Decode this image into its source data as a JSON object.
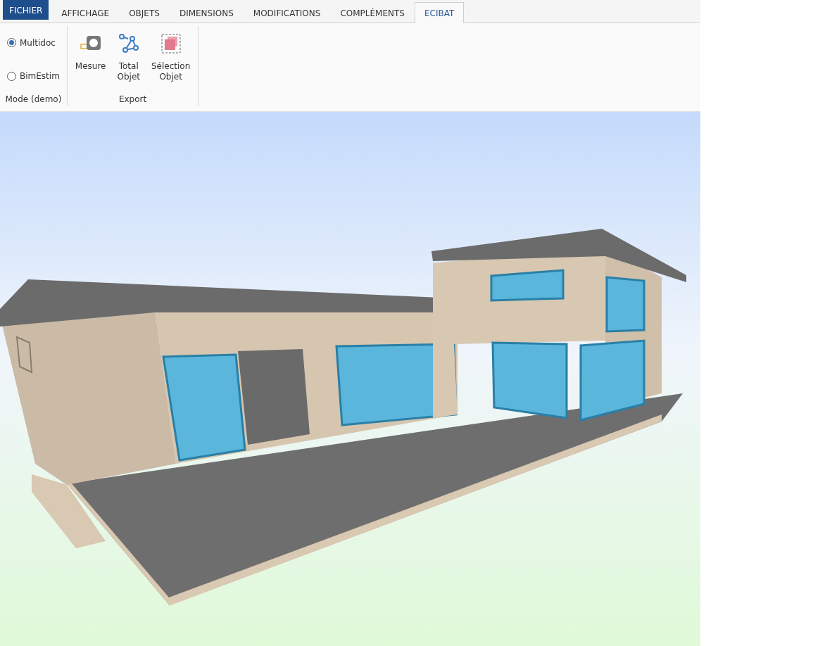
{
  "tabs": [
    {
      "label": "FICHIER",
      "kind": "file",
      "selected": false
    },
    {
      "label": "AFFICHAGE",
      "kind": "tab",
      "selected": false
    },
    {
      "label": "OBJETS",
      "kind": "tab",
      "selected": false
    },
    {
      "label": "DIMENSIONS",
      "kind": "tab",
      "selected": false
    },
    {
      "label": "MODIFICATIONS",
      "kind": "tab",
      "selected": false
    },
    {
      "label": "COMPLÉMENTS",
      "kind": "tab",
      "selected": false
    },
    {
      "label": "ECIBAT",
      "kind": "tab",
      "selected": true
    }
  ],
  "groups": [
    {
      "label": "Mode (demo)",
      "kind": "radios",
      "items": [
        {
          "label": "Multidoc",
          "selected": true
        },
        {
          "label": "BimEstim",
          "selected": false
        }
      ]
    },
    {
      "label": "Export",
      "kind": "buttons",
      "items": [
        {
          "label": "Mesure",
          "kind": "measure"
        },
        {
          "label": "Total Objet",
          "kind": "graph"
        },
        {
          "label": "Sélection Objet",
          "kind": "selection"
        }
      ]
    }
  ]
}
